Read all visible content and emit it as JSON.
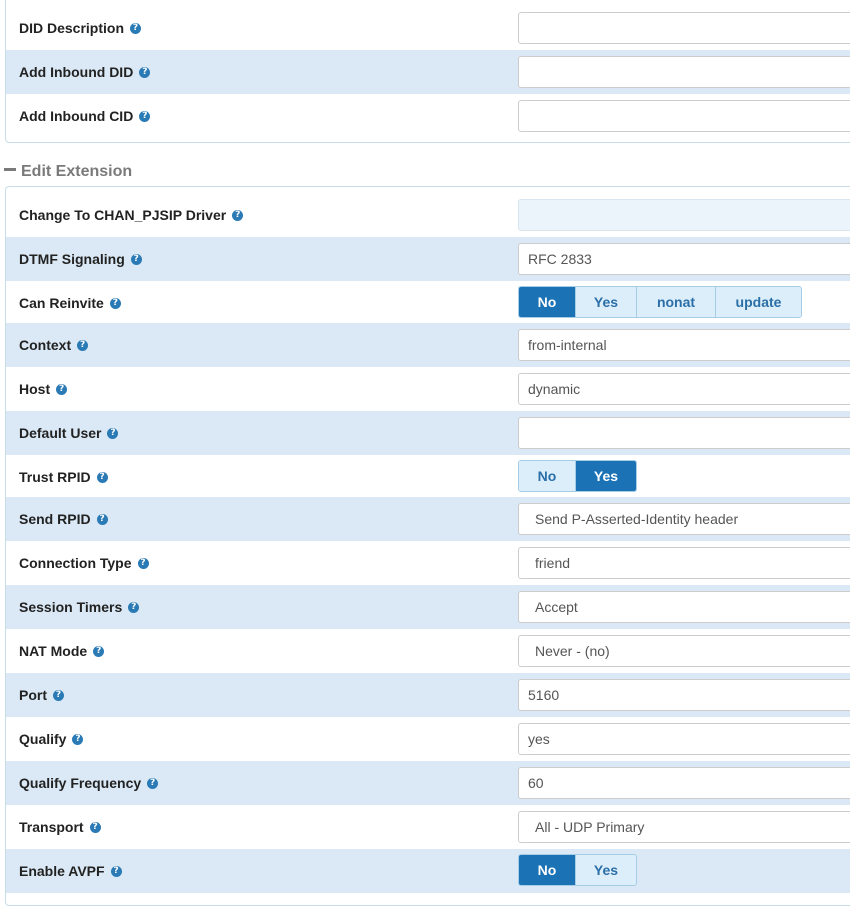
{
  "did_section": {
    "rows": [
      {
        "label": "DID Description",
        "value": ""
      },
      {
        "label": "Add Inbound DID",
        "value": ""
      },
      {
        "label": "Add Inbound CID",
        "value": ""
      }
    ]
  },
  "edit_extension": {
    "title": "Edit Extension",
    "change_driver": {
      "label": "Change To CHAN_PJSIP Driver",
      "value": ""
    },
    "dtmf": {
      "label": "DTMF Signaling",
      "value": "RFC 2833"
    },
    "can_reinvite": {
      "label": "Can Reinvite",
      "options": [
        "No",
        "Yes",
        "nonat",
        "update"
      ],
      "selected": "No"
    },
    "context": {
      "label": "Context",
      "value": "from-internal"
    },
    "host": {
      "label": "Host",
      "value": "dynamic"
    },
    "default_user": {
      "label": "Default User",
      "value": ""
    },
    "trust_rpid": {
      "label": "Trust RPID",
      "options": [
        "No",
        "Yes"
      ],
      "selected": "Yes"
    },
    "send_rpid": {
      "label": "Send RPID",
      "value": "Send P-Asserted-Identity header"
    },
    "connection_type": {
      "label": "Connection Type",
      "value": "friend"
    },
    "session_timers": {
      "label": "Session Timers",
      "value": "Accept"
    },
    "nat_mode": {
      "label": "NAT Mode",
      "value": "Never - (no)"
    },
    "port": {
      "label": "Port",
      "value": "5160"
    },
    "qualify": {
      "label": "Qualify",
      "value": "yes"
    },
    "qualify_frequency": {
      "label": "Qualify Frequency",
      "value": "60"
    },
    "transport": {
      "label": "Transport",
      "value": "All - UDP Primary"
    },
    "enable_avpf": {
      "label": "Enable AVPF",
      "options": [
        "No",
        "Yes"
      ],
      "selected": "No"
    }
  },
  "help_glyph": "?",
  "colors": {
    "row_shade": "#dae9f5",
    "toggle_active": "#1b72b5",
    "toggle_inactive": "#dceef9",
    "help_icon": "#2a7ab5"
  }
}
